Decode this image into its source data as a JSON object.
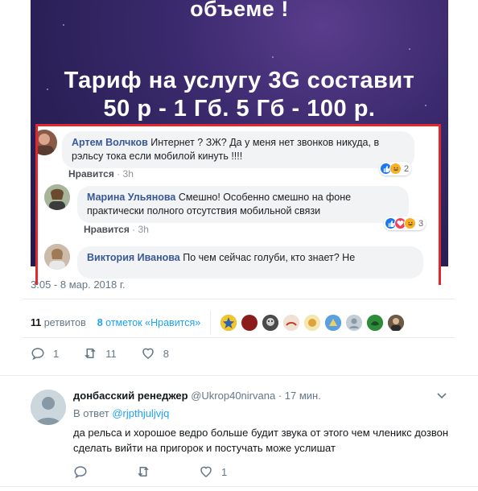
{
  "embed": {
    "line1": "объеме !",
    "line2": "Тариф на услугу 3G составит",
    "line3": "50 р - 1 Гб. 5 Гб - 100 р."
  },
  "comments": [
    {
      "author": "Артем Волчков",
      "text": "Интернет ? ЗЖ? Да у меня нет звонков никуда, в рэльсу тока если мобилой кинуть !!!!",
      "like_label": "Нравится",
      "time": "3h",
      "reaction_count": "2"
    },
    {
      "author": "Марина Ульянова",
      "text": "Смешно! Особенно смешно на фоне практически полного отсутствия мобильной связи",
      "like_label": "Нравится",
      "time": "3h",
      "reaction_count": "3"
    },
    {
      "author": "Виктория Иванова",
      "text": "По чем сейчас голуби, кто знает? Не"
    }
  ],
  "tweet": {
    "timestamp": "3:05 - 8 мар. 2018 г.",
    "retweets_count": "11",
    "retweets_label": "ретвитов",
    "likes_count": "8",
    "likes_label": "отметок «Нравится»",
    "replies": "1",
    "retweets": "11",
    "likes": "8"
  },
  "reply": {
    "name": "донбасский ренеджер",
    "handle": "@Ukrop40nirvana",
    "time": "· 17 мин.",
    "reply_to_label": "В ответ",
    "reply_to_handle": "@rjpthjuljvjq",
    "text": "да рельса и хорошое ведро больше будит звука от этого чем членикс дозвон сделать вийти на пригорок и постучать може услишат",
    "replies": "",
    "retweets": "",
    "likes": "1"
  },
  "colors": {
    "twitter_blue": "#1da1f2",
    "facebook_blue": "#385898",
    "highlight_red": "#e5262c"
  }
}
